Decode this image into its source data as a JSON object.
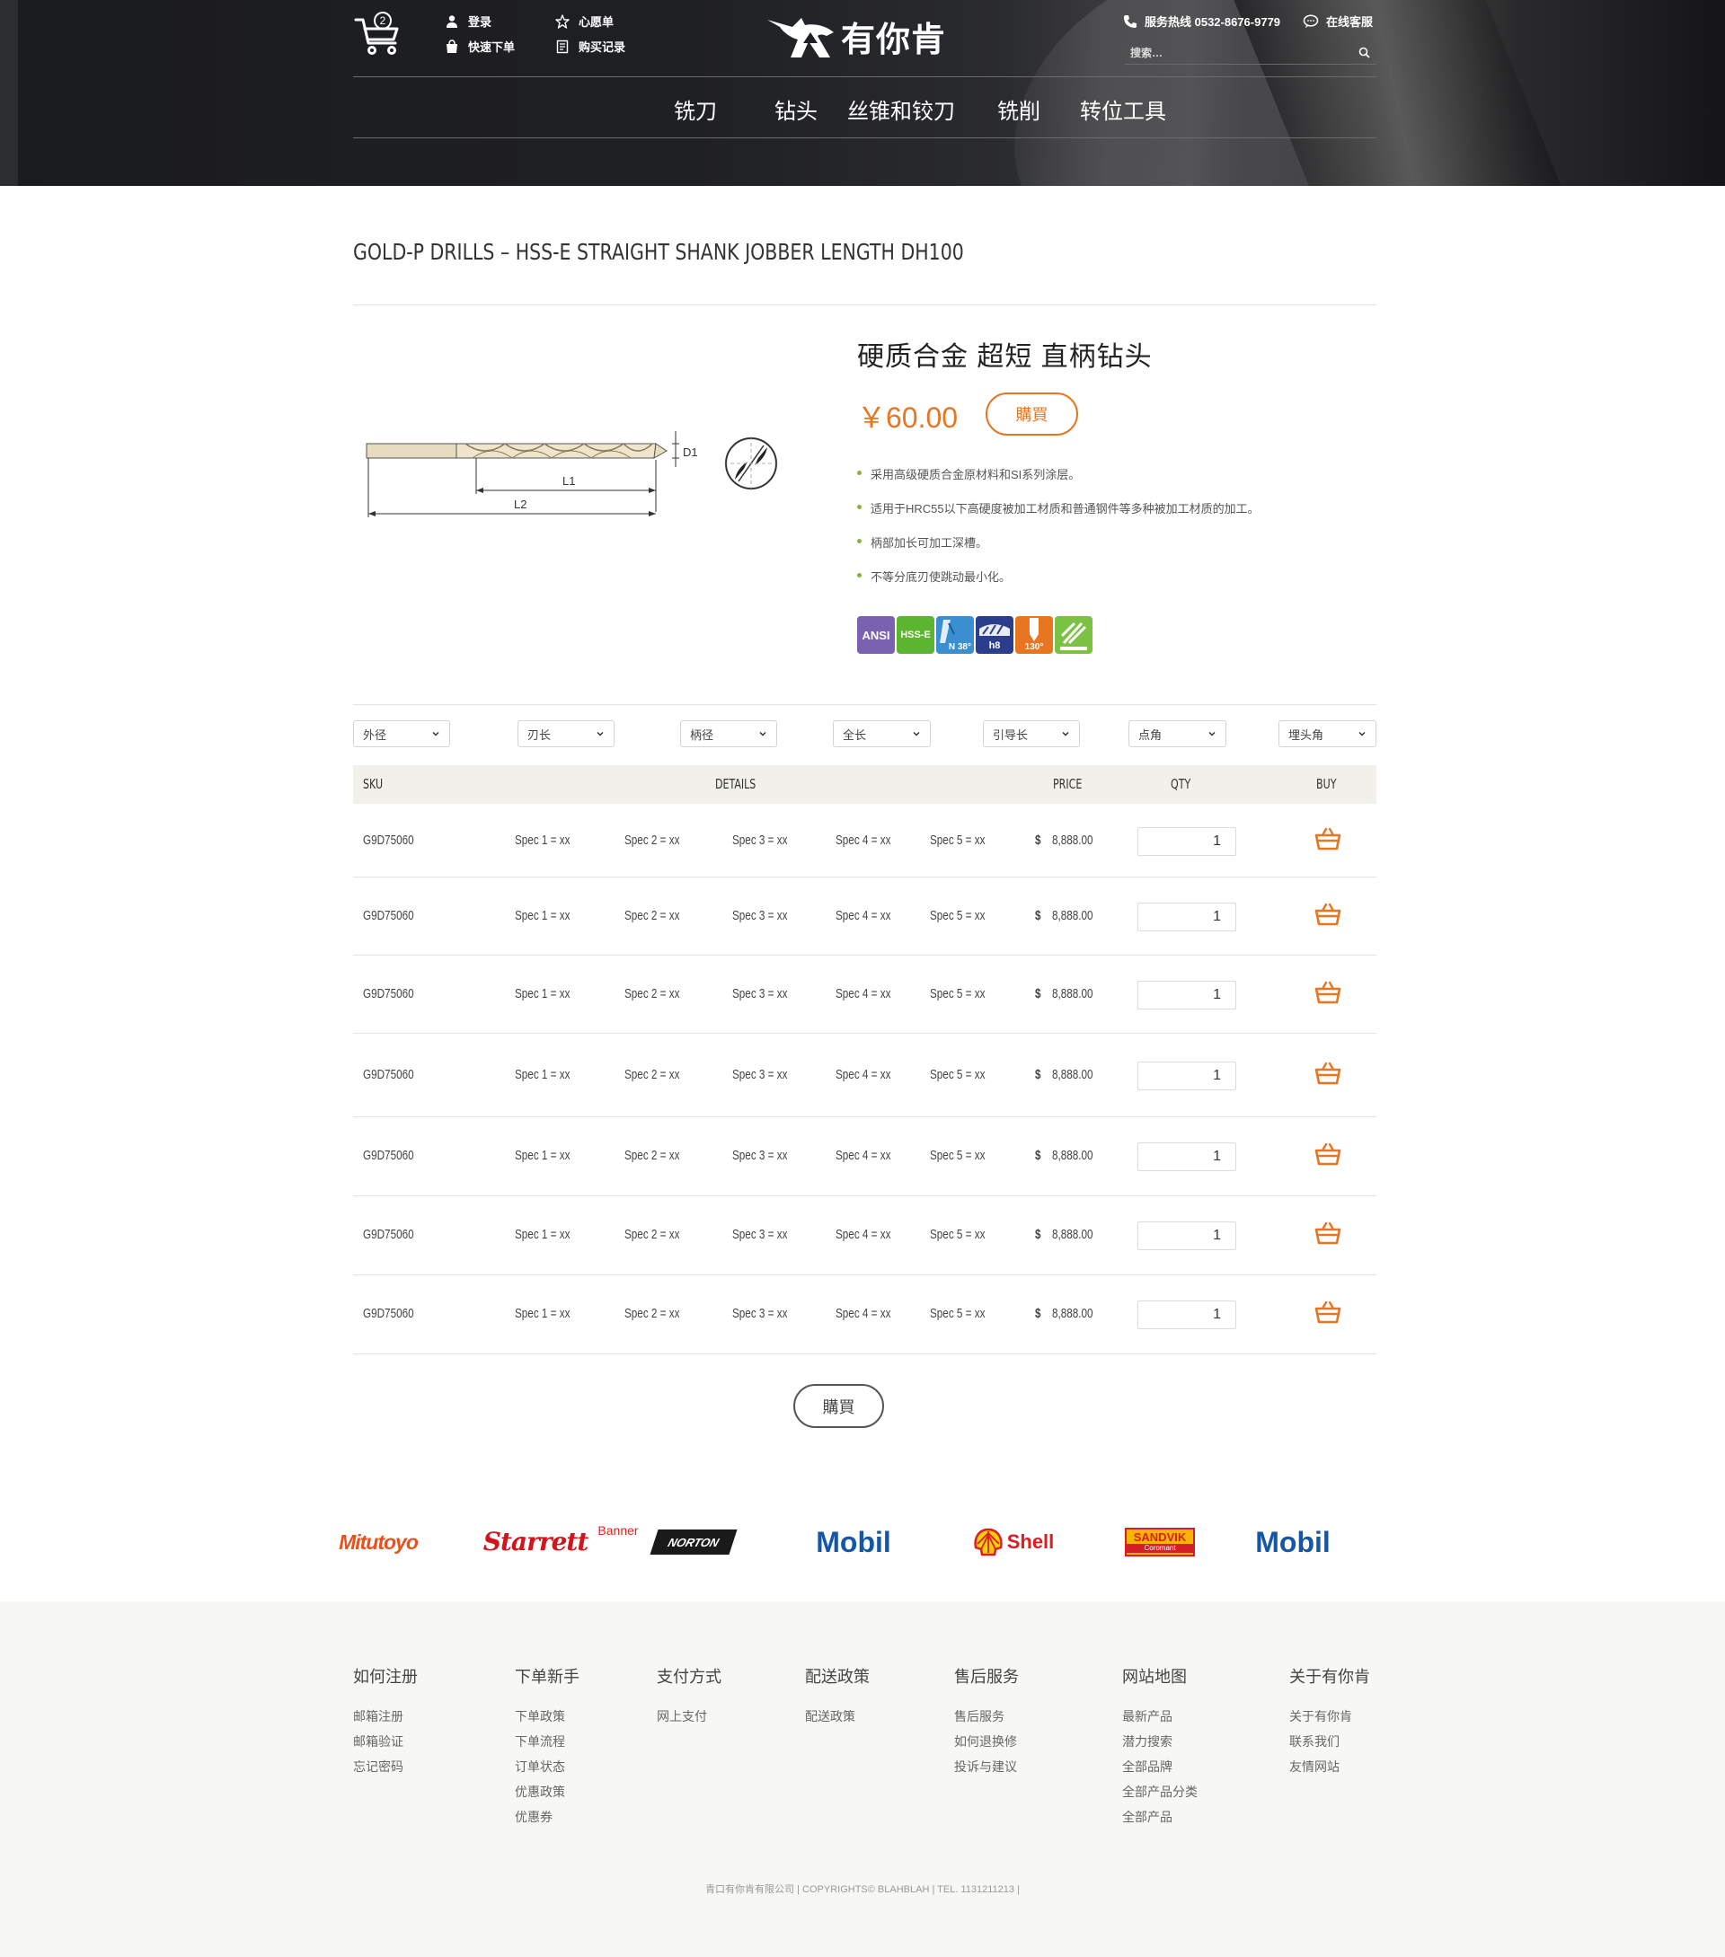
{
  "header": {
    "cart_count": "2",
    "links": {
      "login": "登录",
      "wishlist": "心愿单",
      "quick_order": "快速下单",
      "purchase_history": "购买记录"
    },
    "brand_name": "有你肯",
    "hotline": "服务热线 0532-8676-9779",
    "online_service": "在线客服",
    "search_placeholder": "搜索…",
    "nav": [
      "铣刀",
      "钻头",
      "丝锥和铰刀",
      "铣削",
      "转位工具"
    ]
  },
  "product": {
    "page_title": "GOLD-P DRILLS – HSS-E STRAIGHT SHANK JOBBER LENGTH DH100",
    "name": "硬质合金 超短 直柄钻头",
    "price": "￥60.00",
    "buy_label": "購買",
    "drawing_labels": {
      "d1": "D1",
      "l1": "L1",
      "l2": "L2"
    },
    "features": [
      "采用高级硬质合金原材料和SI系列涂层。",
      "适用于HRC55以下高硬度被加工材质和普通钢件等多种被加工材质的加工。",
      "柄部加长可加工深槽。",
      "不等分底刃使跳动最小化。"
    ],
    "badges": [
      {
        "label": "ANSI",
        "color": "#7a62b0"
      },
      {
        "label": "HSS-E",
        "color": "#5cb531"
      },
      {
        "label": "N 38°",
        "color": "#3a8fd0"
      },
      {
        "label": "h8",
        "color": "#2a3e8c"
      },
      {
        "label": "130°",
        "color": "#e87620"
      },
      {
        "label": "",
        "color": "#7cc242"
      }
    ]
  },
  "filters": [
    "外径",
    "刃长",
    "柄径",
    "全长",
    "引导长",
    "点角",
    "埋头角"
  ],
  "table": {
    "headers": {
      "sku": "SKU",
      "details": "DETAILS",
      "price": "PRICE",
      "qty": "QTY",
      "buy": "BUY"
    },
    "rows": [
      {
        "sku": "G9D75060",
        "specs": [
          "Spec 1 = xx",
          "Spec 2 = xx",
          "Spec 3 = xx",
          "Spec 4 = xx",
          "Spec 5 = xx"
        ],
        "currency": "$",
        "price": "8,888.00",
        "qty": "1"
      },
      {
        "sku": "G9D75060",
        "specs": [
          "Spec 1 = xx",
          "Spec 2 = xx",
          "Spec 3 = xx",
          "Spec 4 = xx",
          "Spec 5 = xx"
        ],
        "currency": "$",
        "price": "8,888.00",
        "qty": "1"
      },
      {
        "sku": "G9D75060",
        "specs": [
          "Spec 1 = xx",
          "Spec 2 = xx",
          "Spec 3 = xx",
          "Spec 4 = xx",
          "Spec 5 = xx"
        ],
        "currency": "$",
        "price": "8,888.00",
        "qty": "1"
      },
      {
        "sku": "G9D75060",
        "specs": [
          "Spec 1 = xx",
          "Spec 2 = xx",
          "Spec 3 = xx",
          "Spec 4 = xx",
          "Spec 5 = xx"
        ],
        "currency": "$",
        "price": "8,888.00",
        "qty": "1"
      },
      {
        "sku": "G9D75060",
        "specs": [
          "Spec 1 = xx",
          "Spec 2 = xx",
          "Spec 3 = xx",
          "Spec 4 = xx",
          "Spec 5 = xx"
        ],
        "currency": "$",
        "price": "8,888.00",
        "qty": "1"
      },
      {
        "sku": "G9D75060",
        "specs": [
          "Spec 1 = xx",
          "Spec 2 = xx",
          "Spec 3 = xx",
          "Spec 4 = xx",
          "Spec 5 = xx"
        ],
        "currency": "$",
        "price": "8,888.00",
        "qty": "1"
      },
      {
        "sku": "G9D75060",
        "specs": [
          "Spec 1 = xx",
          "Spec 2 = xx",
          "Spec 3 = xx",
          "Spec 4 = xx",
          "Spec 5 = xx"
        ],
        "currency": "$",
        "price": "8,888.00",
        "qty": "1"
      }
    ],
    "bottom_buy_label": "購買"
  },
  "brands": [
    "Mitutoyo",
    "Starrett",
    "Banner",
    "NORTON",
    "Mobil",
    "Shell",
    "SANDVIK",
    "Coromant",
    "Mobil"
  ],
  "footer": {
    "columns": [
      {
        "title": "如何注册",
        "links": [
          "邮箱注册",
          "邮箱验证",
          "忘记密码"
        ]
      },
      {
        "title": "下单新手",
        "links": [
          "下单政策",
          "下单流程",
          "订单状态",
          "优惠政策",
          "优惠券"
        ]
      },
      {
        "title": "支付方式",
        "links": [
          "网上支付"
        ]
      },
      {
        "title": "配送政策",
        "links": [
          "配送政策"
        ]
      },
      {
        "title": "售后服务",
        "links": [
          "售后服务",
          "如何退换修",
          "投诉与建议"
        ]
      },
      {
        "title": "网站地图",
        "links": [
          "最新产品",
          "潜力搜索",
          "全部品牌",
          "全部产品分类",
          "全部产品"
        ]
      },
      {
        "title": "关于有你肯",
        "links": [
          "关于有你肯",
          "联系我们",
          "友情网站"
        ]
      }
    ],
    "copyright": "青口有你肯有限公司 | COPYRIGHTS© BLAHBLAH | TEL. 1131211213 |"
  },
  "colors": {
    "accent": "#e87620",
    "bullet": "#8bb13a",
    "table_header_bg": "#f1f0ea",
    "footer_bg": "#f7f7f5"
  }
}
